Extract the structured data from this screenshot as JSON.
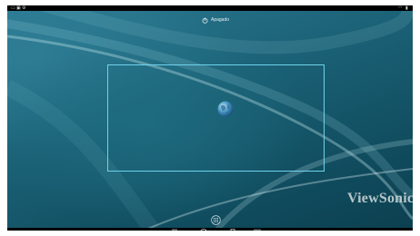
{
  "device": {
    "title": "Apagado",
    "brand": "ViewSonic"
  },
  "icons": {
    "status_left": [
      "usb-icon",
      "screenshot-icon",
      "settings-icon"
    ],
    "status_right": [
      "wifi-icon",
      "battery-icon"
    ],
    "title": "power-icon",
    "center": "globe-icon",
    "apps": "apps-grid-icon",
    "nav": [
      "back-icon",
      "home-icon",
      "recents-icon",
      "screenshot-icon"
    ]
  },
  "colors": {
    "wallpaper": "#1a5f74",
    "selection": "#6fd2ea",
    "bars": "#000000"
  }
}
